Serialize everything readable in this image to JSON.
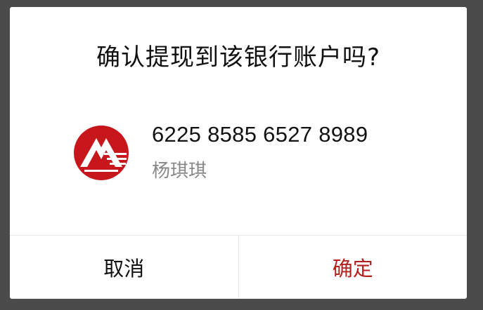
{
  "dialog": {
    "title": "确认提现到该银行账户吗?",
    "account": {
      "bank_icon": "cmb-bank-logo",
      "card_number": "6225 8585 6527 8989",
      "holder_name": "杨琪琪"
    },
    "buttons": {
      "cancel_label": "取消",
      "confirm_label": "确定"
    }
  },
  "colors": {
    "overlay": "#4b4b4b",
    "dialog_background": "#ffffff",
    "primary_text": "#111111",
    "secondary_text": "#888888",
    "confirm_text": "#b3201e",
    "bank_brand": "#c8161d",
    "divider": "#e6e6e6"
  }
}
